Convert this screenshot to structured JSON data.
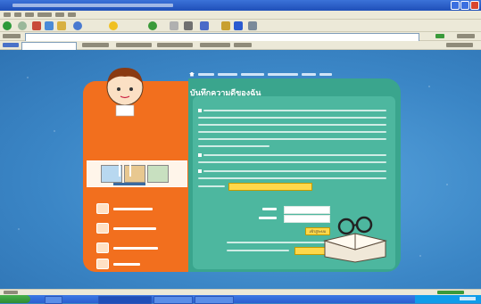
{
  "window": {
    "title": "",
    "menu": [],
    "address_url": "",
    "status_text": ""
  },
  "page": {
    "top_nav": [],
    "content_title": "บันทึกความดีของฉัน",
    "paragraphs": [],
    "banner_caption": "",
    "left_menu": [
      {
        "label": "",
        "icon": "computer-icon"
      },
      {
        "label": "",
        "icon": "notebook-icon"
      },
      {
        "label": "",
        "icon": "trophy-icon"
      },
      {
        "label": "",
        "icon": "group-icon"
      }
    ],
    "login": {
      "username_label": "",
      "password_label": "",
      "username_value": "",
      "password_value": "",
      "submit_label": "เข้าสู่ระบบ"
    },
    "register_note": "",
    "register_link": ""
  },
  "taskbar": {
    "start_label": "",
    "tasks": [],
    "clock": ""
  },
  "colors": {
    "page_bg": "#3f86c4",
    "left_panel": "#f26f1e",
    "green_panel": "#3aa58d",
    "button_yellow": "#ffd84a",
    "titlebar": "#1f4fb8"
  }
}
